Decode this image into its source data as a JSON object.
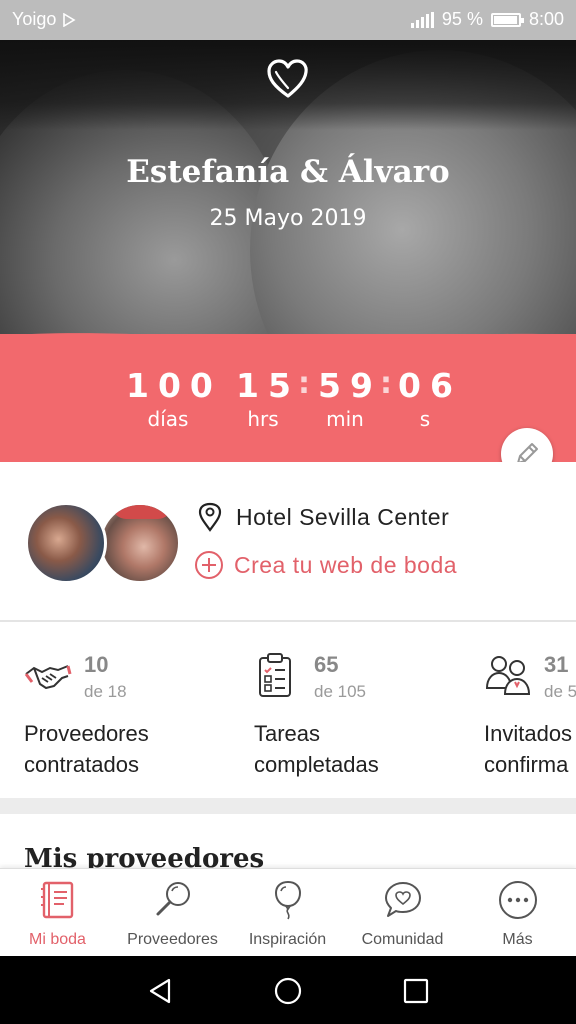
{
  "status_bar": {
    "carrier": "Yoigo",
    "battery_percent": "95 %",
    "battery_level": 0.95,
    "time": "8:00"
  },
  "hero": {
    "couple_names": "Estefanía & Álvaro",
    "wedding_date": "25 Mayo 2019"
  },
  "countdown": {
    "days": "100",
    "days_label": "días",
    "hours": "15",
    "hours_label": "hrs",
    "minutes": "59",
    "minutes_label": "min",
    "seconds": "06",
    "seconds_label": "s"
  },
  "info": {
    "venue": "Hotel Sevilla Center",
    "web_cta": "Crea tu web de boda"
  },
  "stats": [
    {
      "icon": "handshake-icon",
      "count": "10",
      "total": "de 18",
      "label_line1": "Proveedores",
      "label_line2": "contratados"
    },
    {
      "icon": "checklist-icon",
      "count": "65",
      "total": "de 105",
      "label_line1": "Tareas",
      "label_line2": "completadas"
    },
    {
      "icon": "guests-icon",
      "count": "31",
      "total": "de 5",
      "label_line1": "Invitados",
      "label_line2": "confirma"
    }
  ],
  "section": {
    "title": "Mis proveedores"
  },
  "bottom_nav": [
    {
      "label": "Mi boda",
      "icon": "notebook-icon",
      "active": true
    },
    {
      "label": "Proveedores",
      "icon": "magnifier-icon",
      "active": false
    },
    {
      "label": "Inspiración",
      "icon": "balloon-icon",
      "active": false
    },
    {
      "label": "Comunidad",
      "icon": "chat-heart-icon",
      "active": false
    },
    {
      "label": "Más",
      "icon": "more-icon",
      "active": false
    }
  ],
  "colors": {
    "accent": "#f2696d",
    "accent_text": "#e2616a",
    "status_bar": "#bcbcbc"
  }
}
